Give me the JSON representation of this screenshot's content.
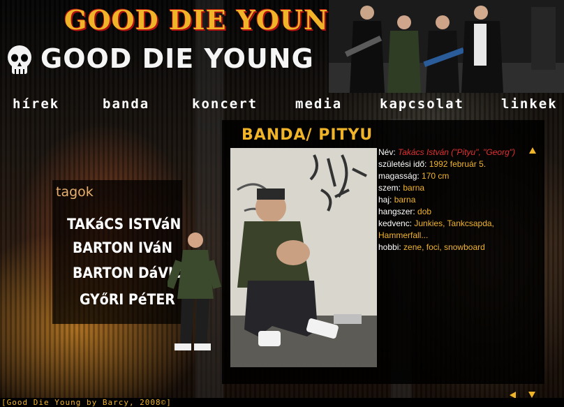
{
  "header": {
    "top_title": "GOOD DIE YOUNG",
    "logo_text": "GOOD DIE YOUNG"
  },
  "nav": {
    "items": [
      "hírek",
      "banda",
      "koncert",
      "media",
      "kapcsolat",
      "linkek"
    ]
  },
  "members": {
    "title": "tagok",
    "list": [
      "TAKáCS ISTVáN",
      "BARTON IVáN",
      "BARTON DáVID",
      "GYőRI PéTER"
    ]
  },
  "section": {
    "title": "BANDA/ PITYU"
  },
  "profile": {
    "name_label": "Név:",
    "name_value": "Takács István (\"Pityu\", \"Georg\")",
    "birth_label": "születési idő:",
    "birth_value": "1992 február 5.",
    "height_label": "magasság:",
    "height_value": "170 cm",
    "eyes_label": "szem:",
    "eyes_value": "barna",
    "hair_label": "haj:",
    "hair_value": "barna",
    "instrument_label": "hangszer:",
    "instrument_value": "dob",
    "fav_label": "kedvenc:",
    "fav_value": "Junkies, Tankcsapda, Hammerfall...",
    "hobby_label": "hobbi:",
    "hobby_value": "zene, foci, snowboard"
  },
  "footer": {
    "text": "[Good Die Young by Barcy, 2008©]"
  },
  "colors": {
    "accent": "#f0b429",
    "highlight": "#e03030"
  }
}
